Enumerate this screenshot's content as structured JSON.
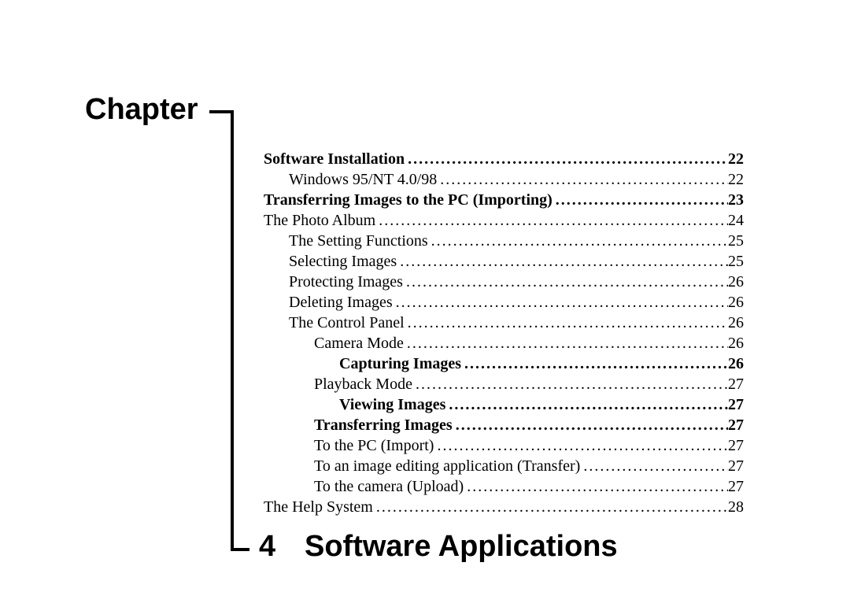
{
  "chapter_label": "Chapter",
  "chapter_number": "4",
  "chapter_title": "Software Applications",
  "toc": [
    {
      "title": "Software Installation",
      "page": "22",
      "bold": true,
      "indent": 0
    },
    {
      "title": "Windows 95/NT 4.0/98",
      "page": "22",
      "bold": false,
      "indent": 1
    },
    {
      "title": "Transferring Images to the PC (Importing)",
      "page": "23",
      "bold": true,
      "indent": 0
    },
    {
      "title": "The Photo Album",
      "page": "24",
      "bold": false,
      "indent": 0
    },
    {
      "title": "The Setting Functions",
      "page": "25",
      "bold": false,
      "indent": 1
    },
    {
      "title": "Selecting Images",
      "page": "25",
      "bold": false,
      "indent": 1
    },
    {
      "title": "Protecting Images",
      "page": "26",
      "bold": false,
      "indent": 1
    },
    {
      "title": "Deleting Images",
      "page": "26",
      "bold": false,
      "indent": 1
    },
    {
      "title": "The Control Panel",
      "page": "26",
      "bold": false,
      "indent": 1
    },
    {
      "title": "Camera Mode",
      "page": "26",
      "bold": false,
      "indent": 2
    },
    {
      "title": "Capturing Images",
      "page": "26",
      "bold": true,
      "indent": 3
    },
    {
      "title": "Playback Mode",
      "page": "27",
      "bold": false,
      "indent": 2
    },
    {
      "title": "Viewing Images",
      "page": "27",
      "bold": true,
      "indent": 3
    },
    {
      "title": "Transferring Images",
      "page": "27",
      "bold": true,
      "indent": 2
    },
    {
      "title": "To the PC  (Import)",
      "page": "27",
      "bold": false,
      "indent": 2
    },
    {
      "title": "To an image editing application  (Transfer)",
      "page": "27",
      "bold": false,
      "indent": 2
    },
    {
      "title": "To the camera (Upload)",
      "page": "27",
      "bold": false,
      "indent": 2
    },
    {
      "title": "The Help System",
      "page": "28",
      "bold": false,
      "indent": 0
    }
  ]
}
